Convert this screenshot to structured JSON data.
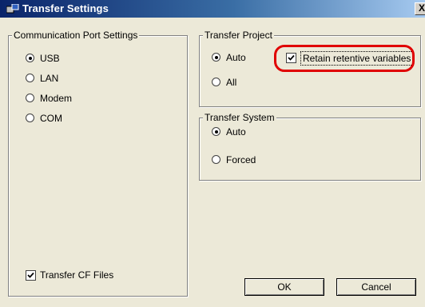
{
  "window": {
    "title": "Transfer Settings",
    "close_glyph": "X"
  },
  "comm_port": {
    "title": "Communication Port Settings",
    "options": [
      {
        "label": "USB",
        "checked": true
      },
      {
        "label": "LAN",
        "checked": false
      },
      {
        "label": "Modem",
        "checked": false
      },
      {
        "label": "COM",
        "checked": false
      }
    ],
    "transfer_cf": {
      "label": "Transfer CF Files",
      "checked": true
    }
  },
  "transfer_project": {
    "title": "Transfer Project",
    "auto_label": "Auto",
    "all_label": "All",
    "selected": "Auto",
    "retain": {
      "label": "Retain retentive variables",
      "checked": true
    }
  },
  "transfer_system": {
    "title": "Transfer System",
    "auto_label": "Auto",
    "forced_label": "Forced",
    "selected": "Auto"
  },
  "buttons": {
    "ok": "OK",
    "cancel": "Cancel"
  },
  "colors": {
    "highlight": "#e00000",
    "dialog_bg": "#ece9d8",
    "title_start": "#0a246a"
  }
}
